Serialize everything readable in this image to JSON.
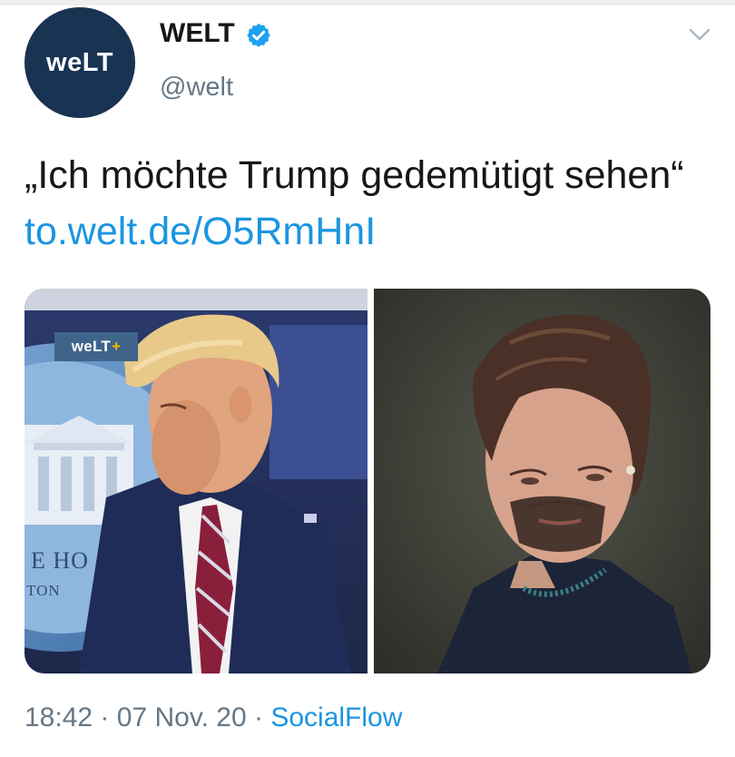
{
  "tweet": {
    "author_name": "WELT",
    "handle": "@welt",
    "avatar_text": "weLT",
    "text_main": "„Ich möchte Trump gedemütigt sehen“",
    "link_text": "to.welt.de/O5RmHnI",
    "timestamp_time": "18:42",
    "timestamp_date": "07 Nov. 20",
    "separator": "·",
    "source": "SocialFlow"
  },
  "media": {
    "badge_text": "weLT",
    "badge_plus": "+",
    "caption_line1": "E HO",
    "caption_line2": "TON"
  },
  "colors": {
    "brand": "#193353",
    "link": "#1b95e0",
    "verified": "#1da1f2",
    "muted": "#657786",
    "text": "#14171a"
  },
  "icons": [
    "verified-badge-icon",
    "chevron-down-icon"
  ]
}
